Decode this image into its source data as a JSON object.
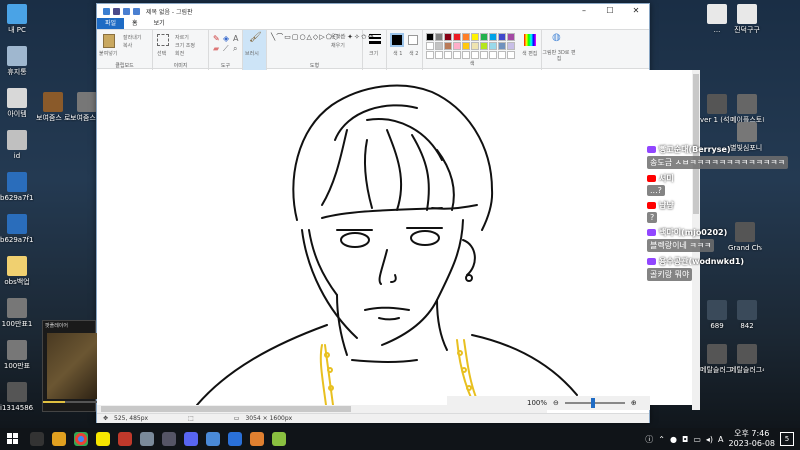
{
  "desktop": {
    "left_icons": [
      {
        "label": "내 PC",
        "color": "#4aa3e6"
      },
      {
        "label": "휴지통",
        "color": "#9fb7cf"
      },
      {
        "label": "아이템",
        "color": "#d8d8d8"
      },
      {
        "label": "id",
        "color": "#c0c0c0"
      },
      {
        "label": "b629a7f10...",
        "color": "#2a6dbb"
      },
      {
        "label": "b629a7f10...",
        "color": "#2a6dbb"
      },
      {
        "label": "obs백업",
        "color": "#f0d070"
      },
      {
        "label": "100만표1",
        "color": "#777"
      },
      {
        "label": "100만표",
        "color": "#777"
      },
      {
        "label": "i1314586...",
        "color": "#555"
      }
    ],
    "second_col": [
      {
        "label": "보여줌스 로고",
        "color": "#8a5a2a"
      },
      {
        "label": "보여줌스 로고11",
        "color": "#777"
      }
    ],
    "right_icons_top": [
      {
        "label": "...",
        "color": "#e8e8e8"
      },
      {
        "label": "진덕구구",
        "color": "#e8e8e8"
      }
    ],
    "right_icons_mid": [
      {
        "label": "ver 1 (석 추...",
        "color": "#555"
      },
      {
        "label": "메이플스토리 BGM / 리앤...",
        "color": "#666"
      },
      {
        "label": "별빛심포니 ~ 지정...",
        "color": "#777"
      }
    ],
    "right_icons_low": [
      {
        "label": "Grand Chase Music - 네...",
        "color": "#555"
      },
      {
        "label": "689",
        "color": "#3a4a5a"
      },
      {
        "label": "842",
        "color": "#3a4a5a"
      },
      {
        "label": "메탈슬러그 bgm 최종...",
        "color": "#555"
      },
      {
        "label": "메탈슬러그4 bgm 1라운드",
        "color": "#555"
      }
    ]
  },
  "paint": {
    "title": "제목 없음 - 그림판",
    "tabs": [
      "파일",
      "홈",
      "보기"
    ],
    "groups": [
      "클립보드",
      "이미지",
      "도구",
      "브러시",
      "도형",
      "크기",
      "색",
      "색 편집",
      "그림판 3D로 편집"
    ],
    "ribbon_items": {
      "paste": "붙여넣기",
      "cut": "잘라내기",
      "copy": "복사",
      "select": "선택",
      "crop": "자르기",
      "resize": "크기 조정",
      "rotate": "회전",
      "outline": "윤곽선",
      "fill": "채우기",
      "color1": "색 1",
      "color2": "색 2",
      "size": "크기"
    },
    "status": {
      "cursor": "525, 485px",
      "dims": "3054 × 1600px"
    },
    "zoom": "100%",
    "palette": [
      "#000000",
      "#7f7f7f",
      "#880015",
      "#ed1c24",
      "#ff7f27",
      "#fff200",
      "#22b14c",
      "#00a2e8",
      "#3f48cc",
      "#a349a4",
      "#ffffff",
      "#c3c3c3",
      "#b97a57",
      "#ffaec9",
      "#ffc90e",
      "#efe4b0",
      "#b5e61d",
      "#99d9ea",
      "#7092be",
      "#c8bfe7",
      "#ffffff",
      "#ffffff",
      "#ffffff",
      "#ffffff",
      "#ffffff",
      "#ffffff",
      "#ffffff",
      "#ffffff",
      "#ffffff",
      "#ffffff"
    ]
  },
  "chat": [
    {
      "platform": "twitch",
      "user": "빵고순대(Berryse)",
      "text": "송도금 ㅅㅂㅋㅋㅋㅋㅋㅋㅋㅋㅋㅋㅋㅋㅋ",
      "badge_color": "#9146ff"
    },
    {
      "platform": "youtube",
      "user": "서미",
      "text": "...?",
      "badge_color": "#ff0000"
    },
    {
      "platform": "youtube",
      "user": "냠냠",
      "text": "?",
      "badge_color": "#ff0000"
    },
    {
      "platform": "twitch",
      "user": "백마이(mjo0202)",
      "text": "블렉랑이네 ㅋㅋㅋ",
      "badge_color": "#9146ff"
    },
    {
      "platform": "twitch",
      "user": "용수공관(wodnwkd1)",
      "text": "골키랑 뭐야",
      "badge_color": "#9146ff"
    }
  ],
  "player": {
    "title": "팟플레이어"
  },
  "taskbar": {
    "time": "오후 7:46",
    "date": "2023-06-08",
    "ime": "A",
    "notif_count": "5"
  }
}
